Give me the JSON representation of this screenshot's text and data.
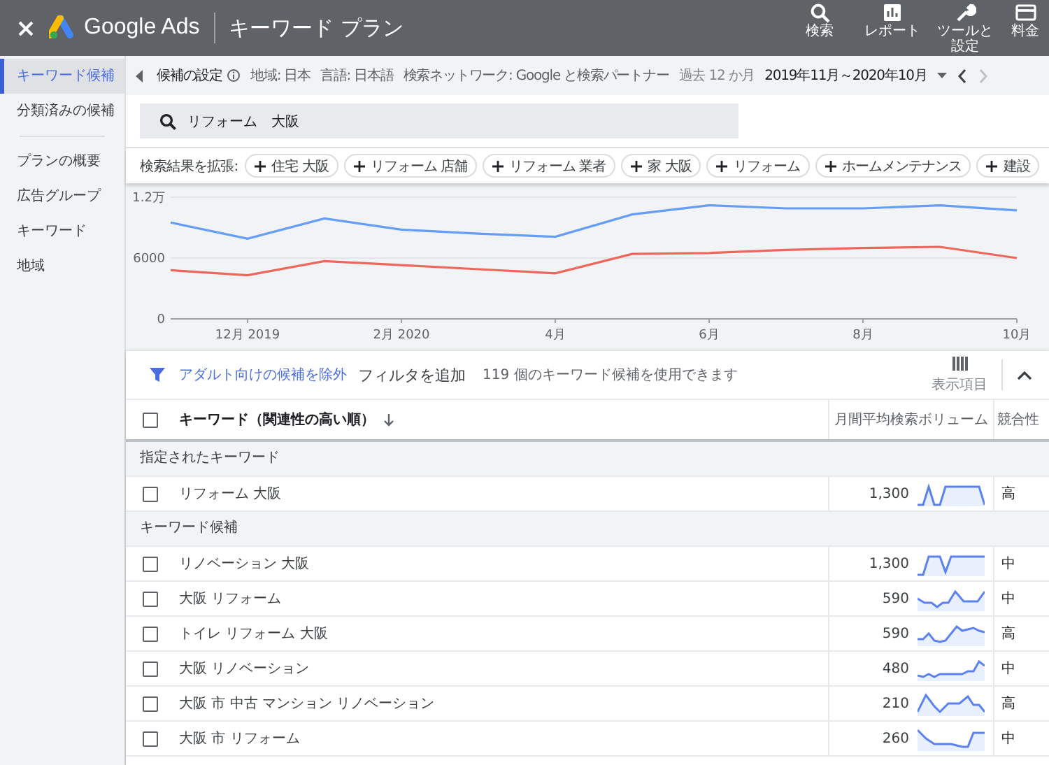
{
  "app_bar": {
    "logo_text": "Google Ads",
    "title": "キーワード プラン",
    "actions": [
      {
        "label": "検索"
      },
      {
        "label": "レポート"
      },
      {
        "label": "ツールと設定"
      },
      {
        "label": "料金"
      }
    ]
  },
  "sidebar": {
    "groups": [
      [
        {
          "label": "キーワード候補",
          "selected": true
        },
        {
          "label": "分類済みの候補",
          "selected": false
        }
      ],
      [
        {
          "label": "プランの概要",
          "selected": false
        },
        {
          "label": "広告グループ",
          "selected": false
        },
        {
          "label": "キーワード",
          "selected": false
        },
        {
          "label": "地域",
          "selected": false
        }
      ]
    ]
  },
  "settings_bar": {
    "title": "候補の設定",
    "location": "地域: 日本",
    "language": "言語: 日本語",
    "network": "検索ネットワーク: Google と検索パートナー",
    "period_label": "過去 12 か月",
    "period": "2019年11月～2020年10月"
  },
  "search": {
    "value": "リフォーム　大阪"
  },
  "expand": {
    "label": "検索結果を拡張:",
    "chips": [
      "住宅 大阪",
      "リフォーム 店舗",
      "リフォーム 業者",
      "家 大阪",
      "リフォーム",
      "ホームメンテナンス",
      "建設"
    ]
  },
  "chart": {
    "top_label": "1.2万",
    "chart_data": {
      "type": "line",
      "categories": [
        null,
        "12月 2019",
        null,
        "2月 2020",
        null,
        "4月",
        null,
        "6月",
        null,
        "8月",
        null,
        "10月"
      ],
      "ylim": [
        0,
        12000
      ],
      "yticks": [
        0,
        6000
      ],
      "series": [
        {
          "color": "#669df6",
          "values": [
            9500,
            7900,
            9900,
            8800,
            8400,
            8100,
            10300,
            11200,
            10900,
            10900,
            11200,
            10700
          ]
        },
        {
          "color": "#ee675c",
          "values": [
            4800,
            4300,
            5700,
            5300,
            4900,
            4500,
            6400,
            6500,
            6800,
            7000,
            7100,
            6000
          ]
        }
      ]
    }
  },
  "filter_bar": {
    "adult_filter": "アダルト向けの候補を除外",
    "add_filter": "フィルタを追加",
    "count": "119 個のキーワード候補を使用できます",
    "columns_button": "表示項目"
  },
  "table": {
    "select_all_checked": false,
    "columns": [
      "キーワード（関連性の高い順）",
      "月間平均検索ボリューム",
      "競合性"
    ],
    "groups": [
      {
        "title": "指定されたキーワード",
        "rows": [
          {
            "keyword": "リフォーム 大阪",
            "volume": "1,300",
            "competition": "高",
            "checked": false
          }
        ]
      },
      {
        "title": "キーワード候補",
        "rows": [
          {
            "keyword": "リノベーション 大阪",
            "volume": "1,300",
            "competition": "中",
            "checked": false
          },
          {
            "keyword": "大阪 リフォーム",
            "volume": "590",
            "competition": "中",
            "checked": false
          },
          {
            "keyword": "トイレ リフォーム 大阪",
            "volume": "590",
            "competition": "高",
            "checked": false
          },
          {
            "keyword": "大阪 リノベーション",
            "volume": "480",
            "competition": "中",
            "checked": false
          },
          {
            "keyword": "大阪 市 中古 マンション リノベーション",
            "volume": "210",
            "competition": "高",
            "checked": false
          },
          {
            "keyword": "大阪 市 リフォーム",
            "volume": "260",
            "competition": "中",
            "checked": false
          }
        ]
      }
    ]
  }
}
